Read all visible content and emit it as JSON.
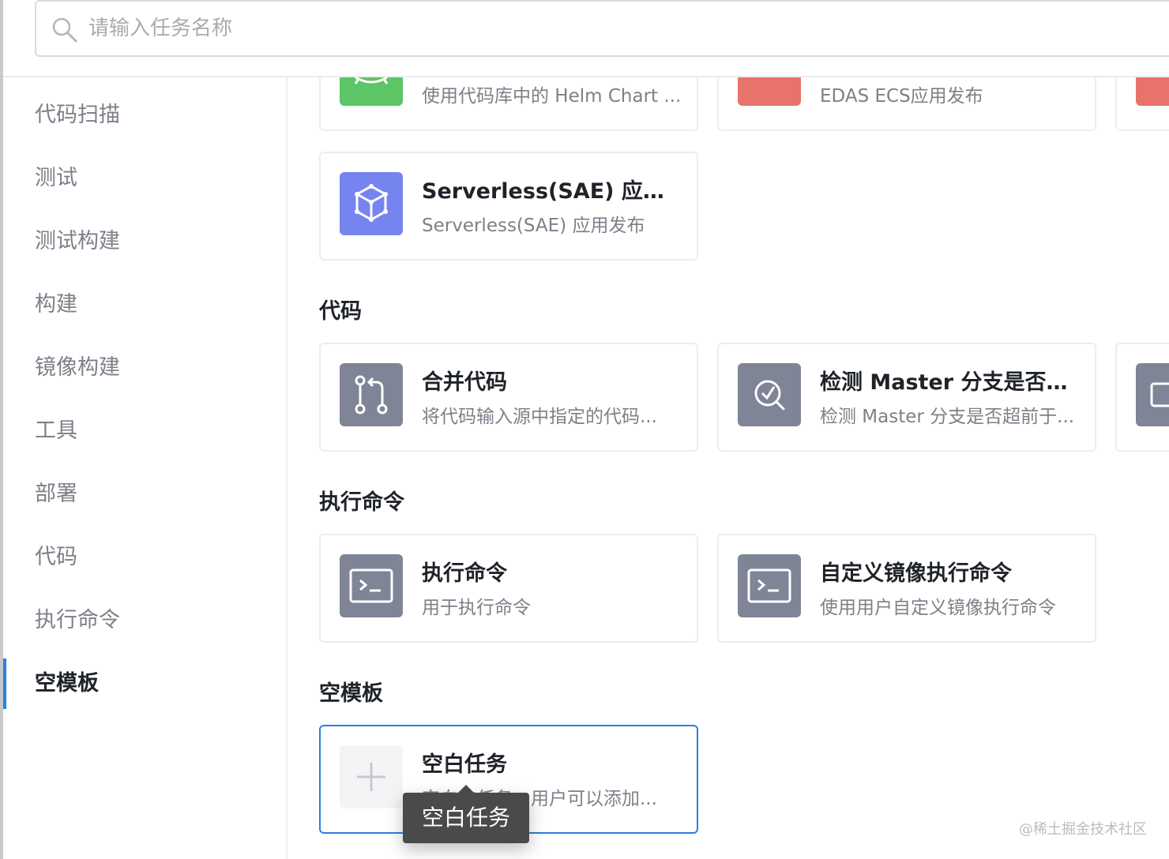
{
  "search": {
    "placeholder": "请输入任务名称"
  },
  "sidebar": {
    "items": [
      {
        "label": "代码扫描"
      },
      {
        "label": "测试"
      },
      {
        "label": "测试构建"
      },
      {
        "label": "构建"
      },
      {
        "label": "镜像构建"
      },
      {
        "label": "工具"
      },
      {
        "label": "部署"
      },
      {
        "label": "代码"
      },
      {
        "label": "执行命令"
      },
      {
        "label": "空模板",
        "active": true
      }
    ]
  },
  "deploy_cards": [
    {
      "desc": "使用代码库中的 Helm Chart ...",
      "icon": "helm-icon",
      "color": "#5cc565"
    },
    {
      "desc": "EDAS ECS应用发布",
      "icon": "edas-icon",
      "color": "#e8736b"
    },
    {
      "icon": "edas-icon",
      "color": "#e8736b"
    },
    {
      "title": "Serverless(SAE) 应用发布",
      "desc": "Serverless(SAE) 应用发布",
      "icon": "cube-icon",
      "color": "#7684ef"
    }
  ],
  "sections": [
    {
      "title": "代码",
      "cards": [
        {
          "title": "合并代码",
          "desc": "将代码输入源中指定的代码...",
          "icon": "merge-branch-icon",
          "color": "#7f8596"
        },
        {
          "title": "检测 Master 分支是否更...",
          "desc": "检测 Master 分支是否超前于...",
          "icon": "check-search-icon",
          "color": "#7f8596"
        },
        {
          "icon": "square-icon",
          "color": "#7f8596"
        }
      ]
    },
    {
      "title": "执行命令",
      "cards": [
        {
          "title": "执行命令",
          "desc": "用于执行命令",
          "icon": "terminal-icon",
          "color": "#7f8596"
        },
        {
          "title": "自定义镜像执行命令",
          "desc": "使用用户自定义镜像执行命令",
          "icon": "terminal-icon",
          "color": "#7f8596"
        }
      ]
    },
    {
      "title": "空模板",
      "cards": [
        {
          "title": "空白任务",
          "desc": "空白的任务，用户可以添加...",
          "icon": "plus-icon",
          "color": "#f3f4f5",
          "selected": true
        }
      ]
    }
  ],
  "tooltip": {
    "text": "空白任务"
  },
  "watermark": "@稀土掘金技术社区",
  "colors": {
    "accent": "#2b7fe0",
    "text_primary": "#1f2329",
    "text_secondary": "#7d8089"
  }
}
